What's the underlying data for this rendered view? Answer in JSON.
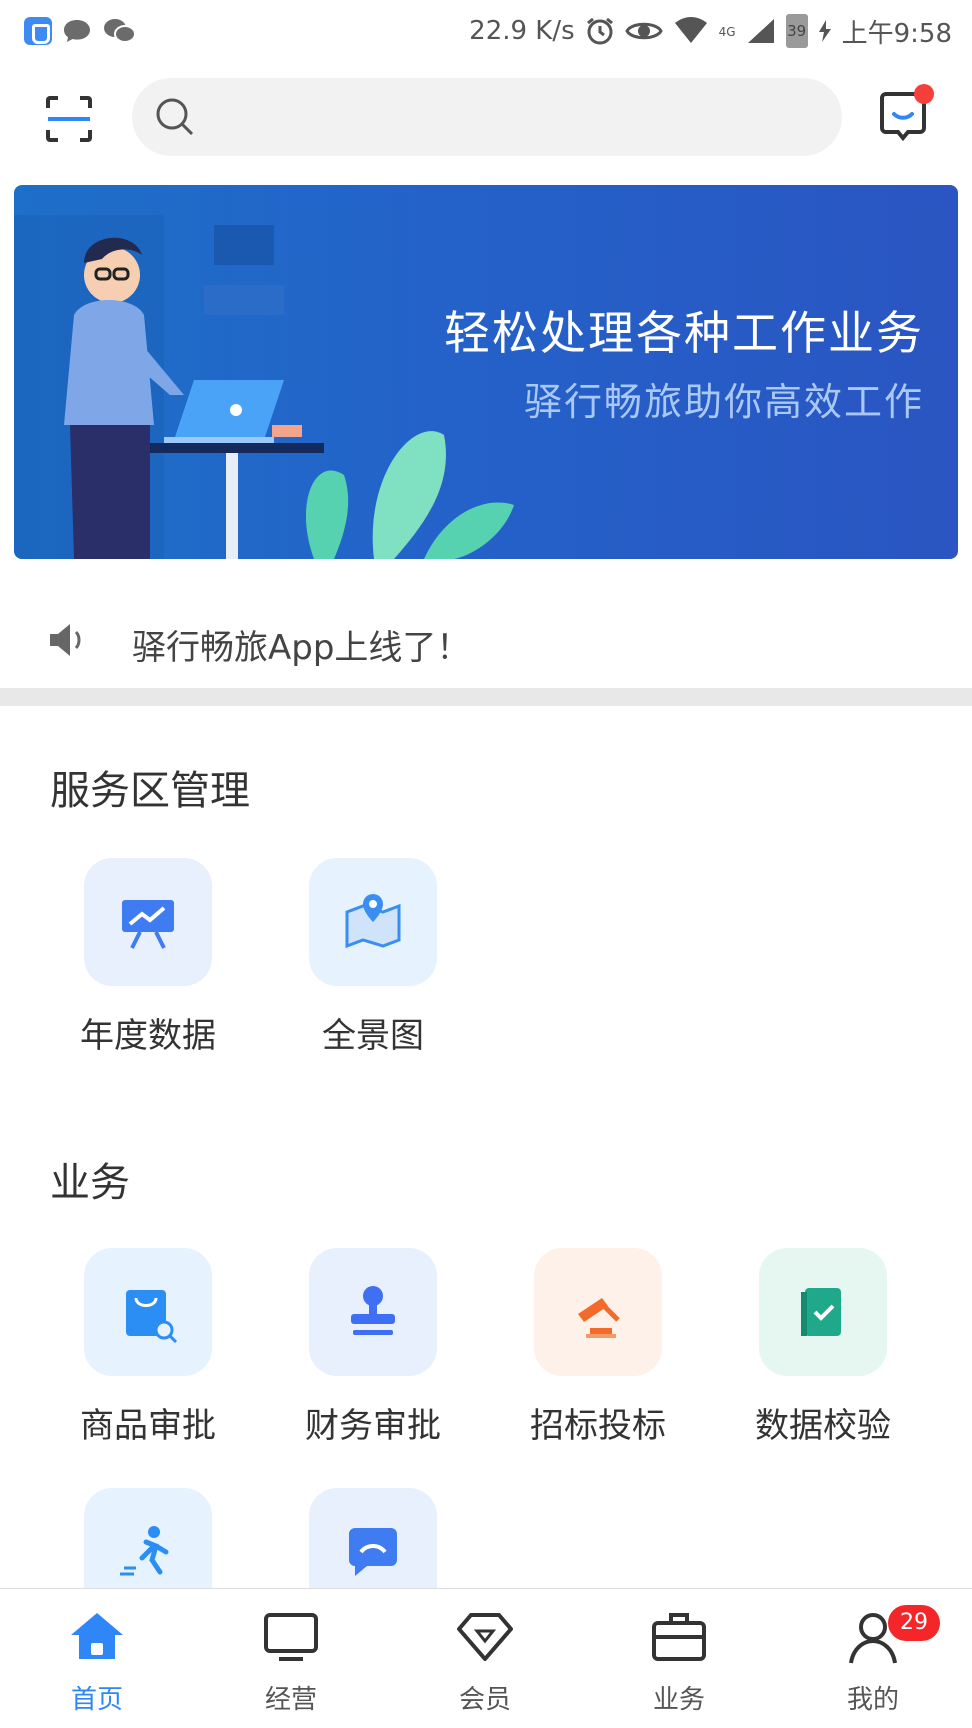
{
  "status_bar": {
    "speed": "22.9 K/s",
    "network": "4G",
    "battery": "39",
    "time": "上午9:58"
  },
  "search": {
    "placeholder": ""
  },
  "banner": {
    "title": "轻松处理各种工作业务",
    "subtitle": "驿行畅旅助你高效工作"
  },
  "notice": {
    "text": "驿行畅旅App上线了！"
  },
  "sections": {
    "service_area": {
      "title": "服务区管理",
      "items": [
        {
          "label": "年度数据",
          "icon": "presentation-chart-icon"
        },
        {
          "label": "全景图",
          "icon": "map-pin-icon"
        }
      ]
    },
    "business": {
      "title": "业务",
      "items": [
        {
          "label": "商品审批",
          "icon": "shopping-bag-search-icon"
        },
        {
          "label": "财务审批",
          "icon": "stamp-icon"
        },
        {
          "label": "招标投标",
          "icon": "gavel-icon"
        },
        {
          "label": "数据校验",
          "icon": "check-book-icon"
        },
        {
          "label": "",
          "icon": "running-man-icon"
        },
        {
          "label": "",
          "icon": "chat-bubble-icon"
        }
      ]
    }
  },
  "bottom_nav": {
    "items": [
      {
        "label": "首页",
        "icon": "home-icon",
        "active": true
      },
      {
        "label": "经营",
        "icon": "monitor-icon"
      },
      {
        "label": "会员",
        "icon": "diamond-icon"
      },
      {
        "label": "业务",
        "icon": "briefcase-icon"
      },
      {
        "label": "我的",
        "icon": "user-icon",
        "badge": "29"
      }
    ]
  },
  "colors": {
    "accent": "#2f86f6",
    "banner": "#2462c9",
    "badge": "#f4262a"
  }
}
